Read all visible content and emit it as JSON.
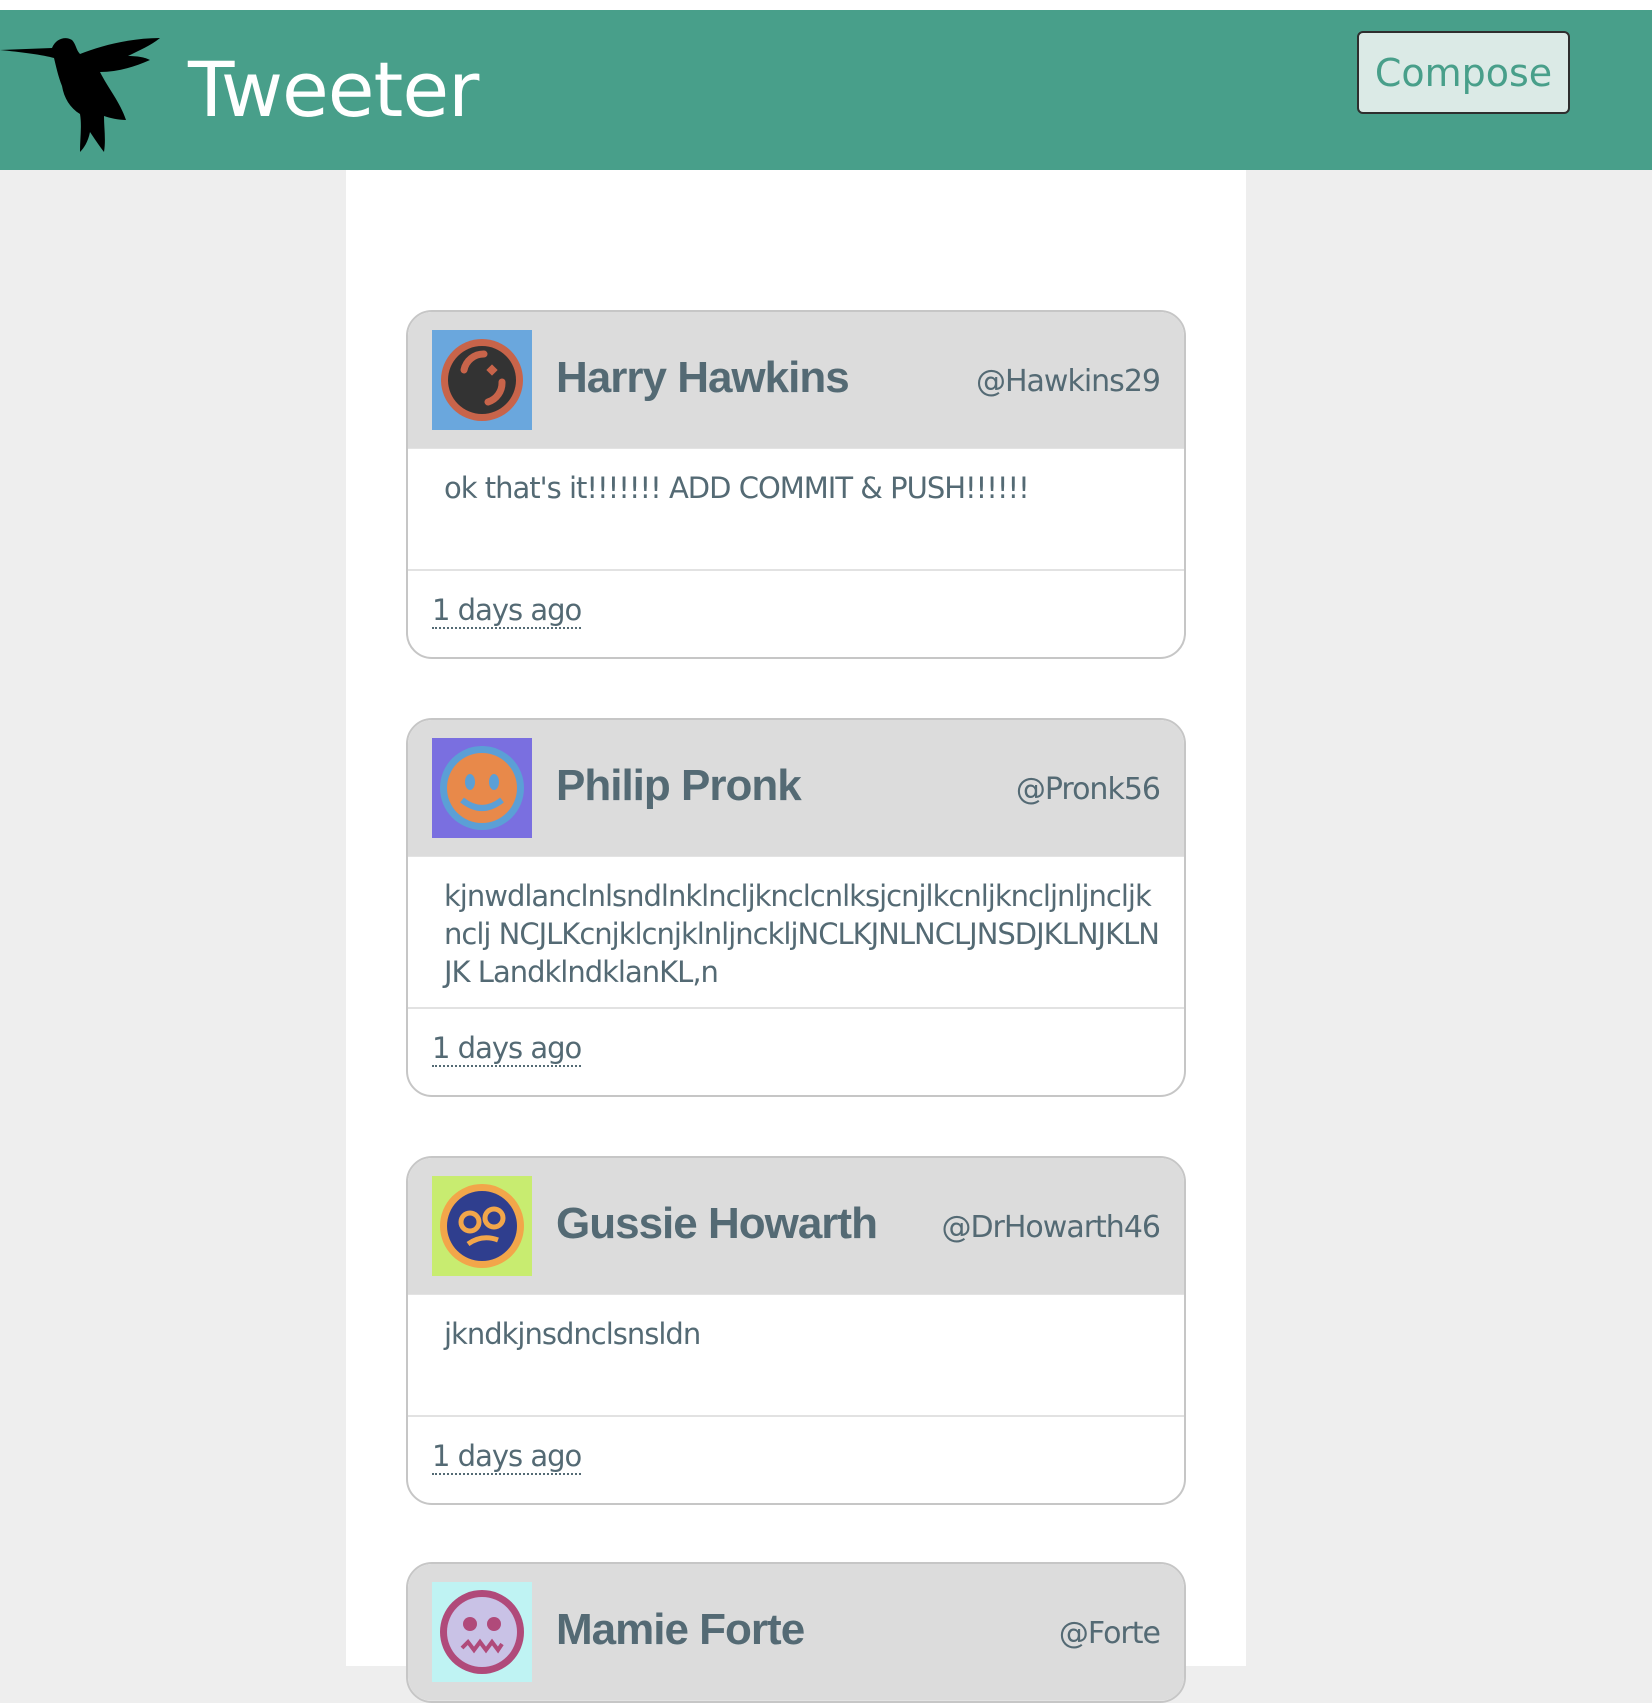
{
  "app": {
    "brand": "Tweeter",
    "compose_label": "Compose",
    "logo_icon": "hummingbird-icon"
  },
  "colors": {
    "navbar": "#489f8a",
    "compose_bg": "#dbeae6",
    "text": "#546a74",
    "header_bg": "#dcdcdc",
    "page_bg": "#eeeeee"
  },
  "tweets": [
    {
      "name": "Harry Hawkins",
      "handle": "@Hawkins29",
      "text": "ok that's it!!!!!!! ADD COMMIT & PUSH!!!!!!",
      "time": "1 days ago",
      "avatar_icon": "avatar-spinner-face-icon",
      "avatar_bg": "#6aa7dd",
      "avatar_ring": "#c8644a",
      "avatar_face": "#333333"
    },
    {
      "name": "Philip Pronk",
      "handle": "@Pronk56",
      "text": "kjnwdlanclnlsndlnklncljknclcnlksjcnjlkcnljkncljnljncljknclj NCJLKcnjklcnjklnljnckljNCLKJNLNCLJNSDJKLNJKLNJK LandklndklanKL,n",
      "time": "1 days ago",
      "avatar_icon": "avatar-smile-face-icon",
      "avatar_bg": "#7a6fe0",
      "avatar_ring": "#5b9fd6",
      "avatar_face": "#e8894a"
    },
    {
      "name": "Gussie Howarth",
      "handle": "@DrHowarth46",
      "text": "jkndkjnsdnclsnsldn",
      "time": "1 days ago",
      "avatar_icon": "avatar-glasses-face-icon",
      "avatar_bg": "#c8ec70",
      "avatar_ring": "#f2a64a",
      "avatar_face": "#2f3e8e"
    },
    {
      "name": "Mamie Forte",
      "handle": "@Forte",
      "text": "",
      "time": "",
      "avatar_icon": "avatar-skull-face-icon",
      "avatar_bg": "#bff3f3",
      "avatar_ring": "#b04a7a",
      "avatar_face": "#c9c2e6"
    }
  ]
}
